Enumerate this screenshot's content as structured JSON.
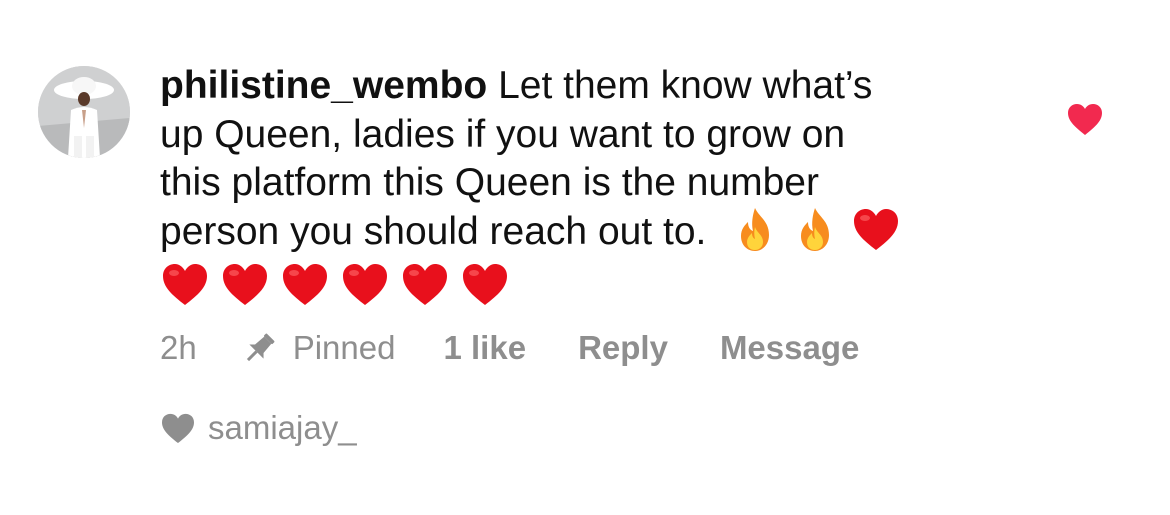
{
  "comment": {
    "username": "philistine_wembo",
    "lines": [
      "Let them know what’s",
      "up Queen, ladies if you want to grow on",
      "this platform this Queen is the number",
      "person you should reach out to."
    ],
    "emojis_line4": [
      "fire",
      "fire",
      "red-heart"
    ],
    "emojis_line5": [
      "red-heart",
      "red-heart",
      "red-heart",
      "red-heart",
      "red-heart",
      "red-heart"
    ]
  },
  "meta": {
    "time": "2h",
    "pinned_label": "Pinned",
    "likes_label": "1 like",
    "reply_label": "Reply",
    "message_label": "Message"
  },
  "liked_by": {
    "username": "samiajay_"
  },
  "colors": {
    "like_heart": "#f2294f",
    "meta_text": "#8e8e8e",
    "emoji_heart": "#e8101c",
    "fire_outer": "#f78c1e",
    "fire_inner": "#ffd43b"
  }
}
